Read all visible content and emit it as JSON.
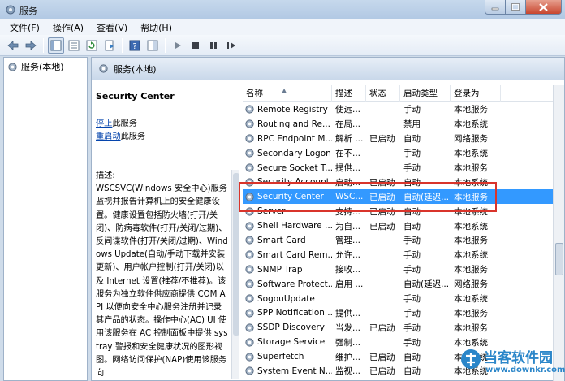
{
  "window": {
    "title": "服务"
  },
  "menu": [
    "文件(F)",
    "操作(A)",
    "查看(V)",
    "帮助(H)"
  ],
  "tree": {
    "root_label": "服务(本地)"
  },
  "pane": {
    "header": "服务(本地)"
  },
  "description": {
    "service_name": "Security Center",
    "stop_link": "停止",
    "stop_suffix": "此服务",
    "restart_link": "重启动",
    "restart_suffix": "此服务",
    "label": "描述:",
    "text": "WSCSVC(Windows 安全中心)服务监视并报告计算机上的安全健康设置。健康设置包括防火墙(打开/关闭)、防病毒软件(打开/关闭/过期)、反间谍软件(打开/关闭/过期)、Windows Update(自动/手动下载并安装更新)、用户帐户控制(打开/关闭)以及 Internet 设置(推荐/不推荐)。该服务为独立软件供应商提供 COM API 以便向安全中心服务注册并记录其产品的状态。操作中心(AC) UI 使用该服务在 AC 控制面板中提供 systray 警报和安全健康状况的图形视图。网络访问保护(NAP)使用该服务向"
  },
  "columns": [
    "名称",
    "描述",
    "状态",
    "启动类型",
    "登录为"
  ],
  "services": [
    {
      "name": "Remote Registry",
      "desc": "使远...",
      "status": "",
      "startup": "手动",
      "logon": "本地服务"
    },
    {
      "name": "Routing and Re...",
      "desc": "在局...",
      "status": "",
      "startup": "禁用",
      "logon": "本地系统"
    },
    {
      "name": "RPC Endpoint M...",
      "desc": "解析 ...",
      "status": "已启动",
      "startup": "自动",
      "logon": "网络服务"
    },
    {
      "name": "Secondary Logon",
      "desc": "在不...",
      "status": "",
      "startup": "手动",
      "logon": "本地系统"
    },
    {
      "name": "Secure Socket T...",
      "desc": "提供...",
      "status": "",
      "startup": "手动",
      "logon": "本地服务"
    },
    {
      "name": "Security Account...",
      "desc": "启动...",
      "status": "已启动",
      "startup": "自动",
      "logon": "本地系统"
    },
    {
      "name": "Security Center",
      "desc": "WSC...",
      "status": "已启动",
      "startup": "自动(延迟...",
      "logon": "本地服务"
    },
    {
      "name": "Server",
      "desc": "支持...",
      "status": "已启动",
      "startup": "自动",
      "logon": "本地系统"
    },
    {
      "name": "Shell Hardware ...",
      "desc": "为自...",
      "status": "已启动",
      "startup": "自动",
      "logon": "本地系统"
    },
    {
      "name": "Smart Card",
      "desc": "管理...",
      "status": "",
      "startup": "手动",
      "logon": "本地服务"
    },
    {
      "name": "Smart Card Rem...",
      "desc": "允许...",
      "status": "",
      "startup": "手动",
      "logon": "本地系统"
    },
    {
      "name": "SNMP Trap",
      "desc": "接收...",
      "status": "",
      "startup": "手动",
      "logon": "本地服务"
    },
    {
      "name": "Software Protect...",
      "desc": "启用 ...",
      "status": "",
      "startup": "自动(延迟...",
      "logon": "网络服务"
    },
    {
      "name": "SogouUpdate",
      "desc": "",
      "status": "",
      "startup": "手动",
      "logon": "本地系统"
    },
    {
      "name": "SPP Notification ...",
      "desc": "提供...",
      "status": "",
      "startup": "手动",
      "logon": "本地服务"
    },
    {
      "name": "SSDP Discovery",
      "desc": "当发...",
      "status": "已启动",
      "startup": "手动",
      "logon": "本地服务"
    },
    {
      "name": "Storage Service",
      "desc": "强制...",
      "status": "",
      "startup": "手动",
      "logon": "本地系统"
    },
    {
      "name": "Superfetch",
      "desc": "维护...",
      "status": "已启动",
      "startup": "自动",
      "logon": "本地系统"
    },
    {
      "name": "System Event N...",
      "desc": "监视...",
      "status": "已启动",
      "startup": "自动",
      "logon": "本地系统"
    }
  ],
  "selected_index": 6,
  "watermark": {
    "name": "当客软件园",
    "url": "www.downkr.com"
  },
  "colors": {
    "selection": "#3399ff",
    "highlight_box": "#d9342b",
    "watermark": "#2b86c9"
  }
}
